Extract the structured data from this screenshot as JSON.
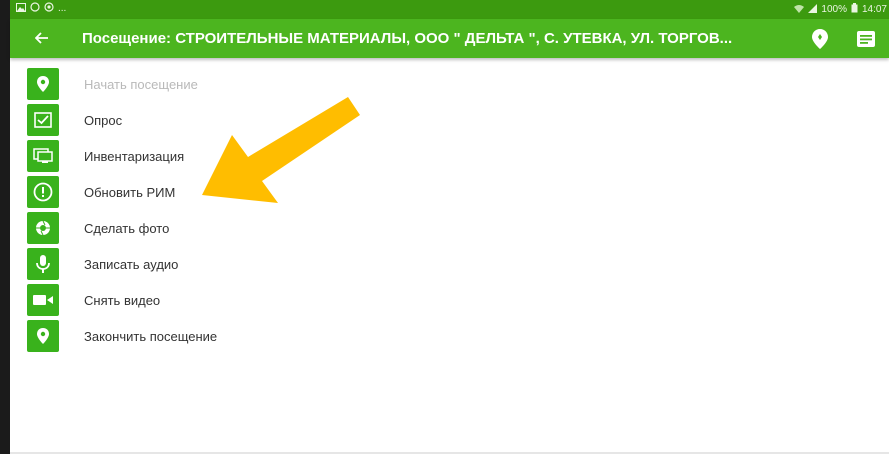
{
  "status_bar": {
    "left_icons": [
      "image-icon",
      "whatsapp-icon",
      "chrome-icon"
    ],
    "ellipsis": "...",
    "signal_icons": [
      "wifi-icon",
      "cell-signal-icon"
    ],
    "battery": "100%",
    "time": "14:07"
  },
  "app_bar": {
    "back_icon": "back-arrow-icon",
    "title": "Посещение: СТРОИТЕЛЬНЫЕ МАТЕРИАЛЫ, ООО \" ДЕЛЬТА \", С. УТЕВКА, УЛ. ТОРГОВ...",
    "actions": [
      "location-pin-icon",
      "menu-list-icon"
    ]
  },
  "menu": {
    "items": [
      {
        "label": "Начать посещение",
        "icon": "location-pin-icon",
        "disabled": true
      },
      {
        "label": "Опрос",
        "icon": "checkbox-icon"
      },
      {
        "label": "Инвентаризация",
        "icon": "monitor-icon"
      },
      {
        "label": "Обновить РИМ",
        "icon": "alert-circle-icon"
      },
      {
        "label": "Сделать фото",
        "icon": "camera-aperture-icon"
      },
      {
        "label": "Записать аудио",
        "icon": "microphone-icon"
      },
      {
        "label": "Снять видео",
        "icon": "video-camera-icon"
      },
      {
        "label": "Закончить посещение",
        "icon": "location-pin-icon"
      }
    ]
  },
  "annotation": {
    "icon": "pointer-arrow-icon",
    "color": "#ffbd00"
  },
  "colors": {
    "status_bar": "#3c9a0f",
    "app_bar": "#4cb51f",
    "icon_tile": "#39b21c"
  }
}
